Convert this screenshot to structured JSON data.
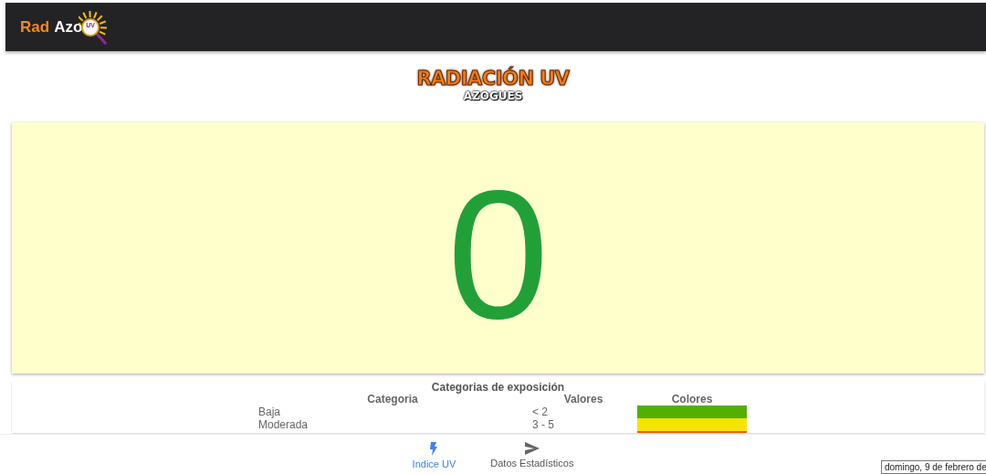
{
  "header": {
    "logo": {
      "part_1": "Rad",
      "part_2": "Azo",
      "badge": "UV"
    }
  },
  "title": {
    "heading": "RADIACIÓN UV",
    "subheading": "AZOGUES"
  },
  "uv_index": {
    "value": "0",
    "color": "#22a038"
  },
  "exposure_table": {
    "title": "Categorias de exposición",
    "columns": [
      "Categoria",
      "Valores",
      "Colores"
    ],
    "rows": [
      {
        "category": "Baja",
        "values": "< 2",
        "color": "#52b000"
      },
      {
        "category": "Moderada",
        "values": "3 - 5",
        "color": "#f6e400"
      },
      {
        "color": "#f05a14"
      }
    ]
  },
  "bottom_nav": [
    {
      "label": "Indice UV",
      "kind": "bolt",
      "selected": true
    },
    {
      "label": "Datos Estadísticos",
      "kind": "send",
      "selected": false
    }
  ],
  "date_box": "domingo, 9 de febrero de"
}
